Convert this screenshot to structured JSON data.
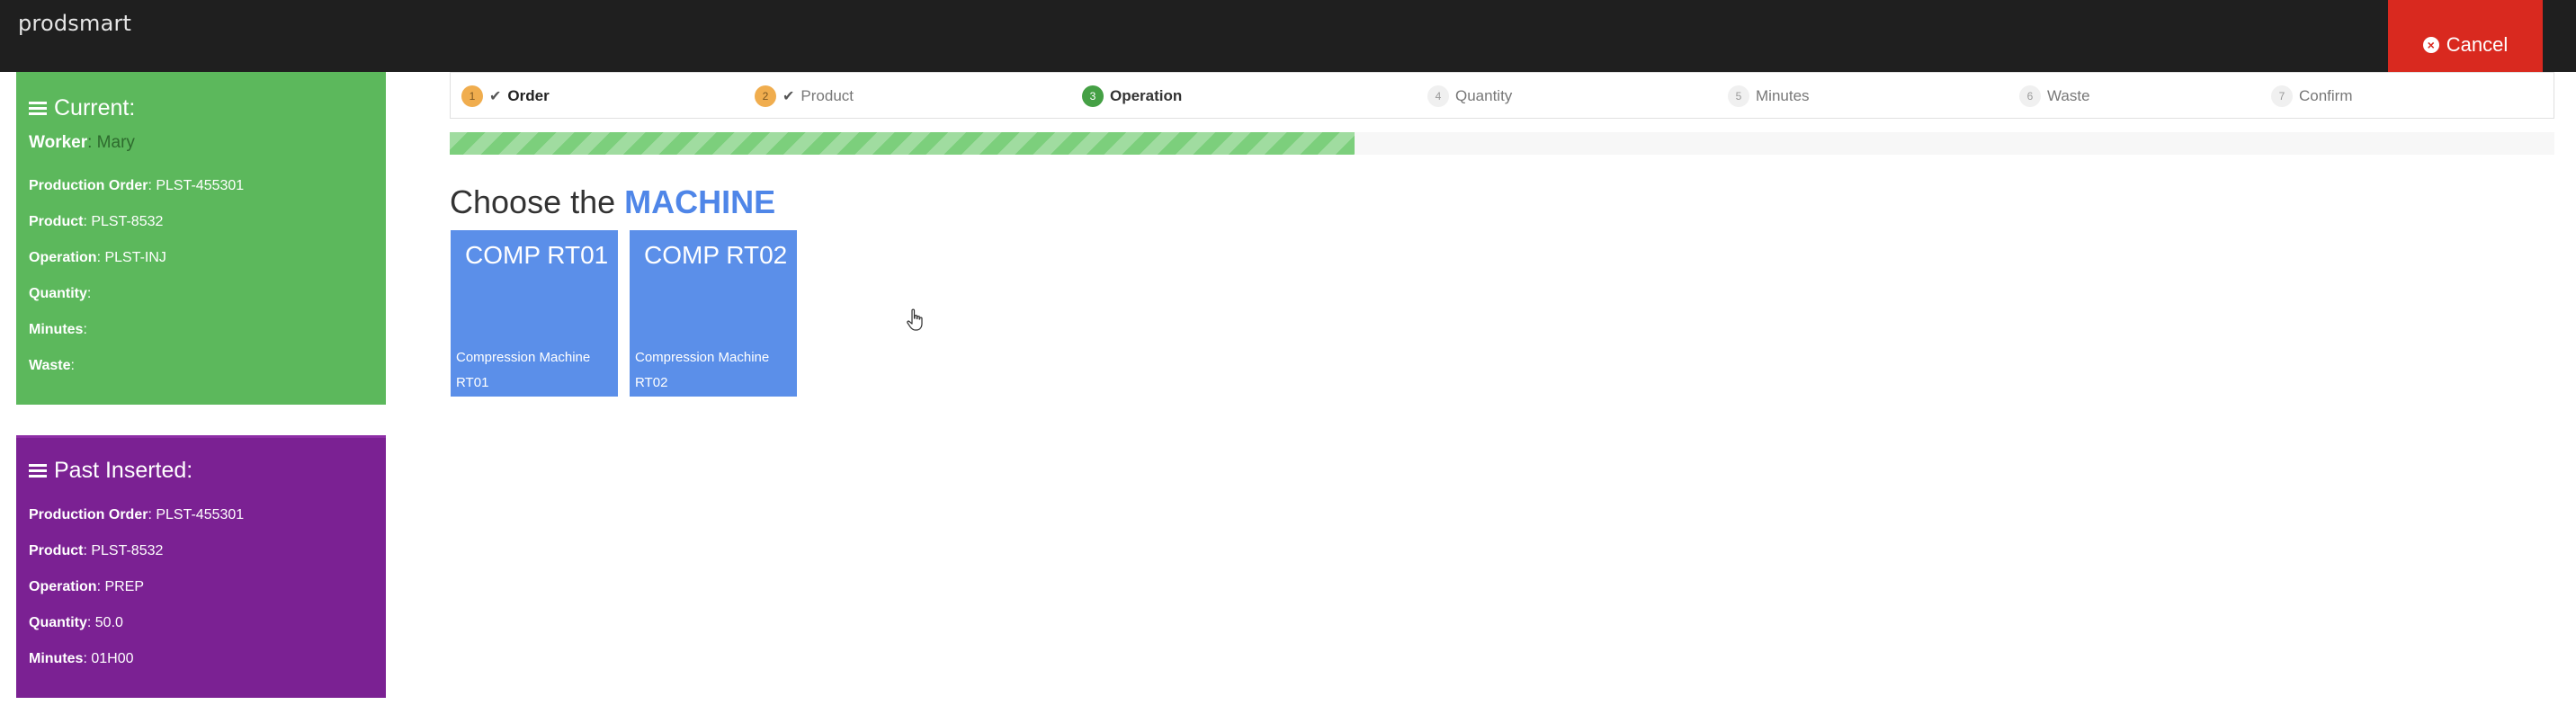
{
  "app": {
    "title": "prodsmart"
  },
  "header": {
    "cancel_label": "Cancel"
  },
  "current_panel": {
    "title": "Current:",
    "worker_label": "Worker",
    "worker_value": ": Mary",
    "rows": [
      {
        "label": "Production Order",
        "value": ": PLST-455301"
      },
      {
        "label": "Product",
        "value": ": PLST-8532"
      },
      {
        "label": "Operation",
        "value": ": PLST-INJ"
      },
      {
        "label": "Quantity",
        "value": ":"
      },
      {
        "label": "Minutes",
        "value": ":"
      },
      {
        "label": "Waste",
        "value": ":"
      }
    ]
  },
  "past_panel": {
    "title": "Past Inserted:",
    "rows": [
      {
        "label": "Production Order",
        "value": ": PLST-455301"
      },
      {
        "label": "Product",
        "value": ": PLST-8532"
      },
      {
        "label": "Operation",
        "value": ": PREP"
      },
      {
        "label": "Quantity",
        "value": ": 50.0"
      },
      {
        "label": "Minutes",
        "value": ": 01H00"
      }
    ]
  },
  "steps": [
    {
      "num": "1",
      "label": "Order",
      "state": "done"
    },
    {
      "num": "2",
      "label": "Product",
      "state": "done"
    },
    {
      "num": "3",
      "label": "Operation",
      "state": "active"
    },
    {
      "num": "4",
      "label": "Quantity",
      "state": "pending"
    },
    {
      "num": "5",
      "label": "Minutes",
      "state": "pending"
    },
    {
      "num": "6",
      "label": "Waste",
      "state": "pending"
    },
    {
      "num": "7",
      "label": "Confirm",
      "state": "pending"
    }
  ],
  "progress": {
    "fraction": 0.43
  },
  "main": {
    "heading_prefix": "Choose the ",
    "heading_accent": "MACHINE",
    "machines": [
      {
        "code": "COMP RT01",
        "desc": "Compression Machine RT01"
      },
      {
        "code": "COMP RT02",
        "desc": "Compression Machine RT02"
      }
    ]
  },
  "colors": {
    "topbar": "#1f1f1f",
    "cancel": "#d9291f",
    "current_panel": "#5cb85c",
    "past_panel": "#7b2193",
    "machine_card": "#5b8fe9",
    "progress": "#7ccf7c",
    "step_done": "#f0ad4e",
    "step_active": "#45a045"
  },
  "icons": {
    "cancel": "times-circle-icon",
    "panel": "hamburger-menu-icon",
    "step_done": "checkmark-icon",
    "cursor": "hand-pointer-icon"
  }
}
